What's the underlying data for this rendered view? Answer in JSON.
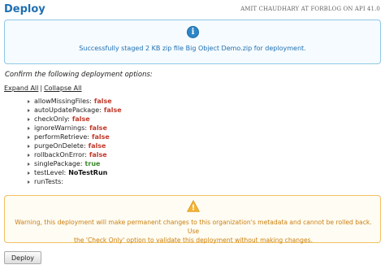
{
  "header": {
    "title": "Deploy",
    "user_info": "AMIT CHAUDHARY AT FORBLOG ON API 41.0"
  },
  "success": {
    "icon": "info-icon",
    "icon_glyph": "i",
    "message": "Successfully staged 2 KB zip file Big Object Demo.zip for deployment."
  },
  "confirm_text": "Confirm the following deployment options:",
  "links": {
    "expand_all": "Expand All",
    "separator": "|",
    "collapse_all": "Collapse All"
  },
  "options": [
    {
      "key": "allowMissingFiles:",
      "value": "false",
      "kind": "false"
    },
    {
      "key": "autoUpdatePackage:",
      "value": "false",
      "kind": "false"
    },
    {
      "key": "checkOnly:",
      "value": "false",
      "kind": "false"
    },
    {
      "key": "ignoreWarnings:",
      "value": "false",
      "kind": "false"
    },
    {
      "key": "performRetrieve:",
      "value": "false",
      "kind": "false"
    },
    {
      "key": "purgeOnDelete:",
      "value": "false",
      "kind": "false"
    },
    {
      "key": "rollbackOnError:",
      "value": "false",
      "kind": "false"
    },
    {
      "key": "singlePackage:",
      "value": "true",
      "kind": "true"
    },
    {
      "key": "testLevel:",
      "value": "NoTestRun",
      "kind": "other"
    },
    {
      "key": "runTests:",
      "value": "",
      "kind": "other"
    }
  ],
  "warning": {
    "icon": "warning-icon",
    "icon_glyph": "!",
    "line1": "Warning, this deployment will make permanent changes to this organization's metadata and cannot be rolled back. Use",
    "line2": "the 'Check Only' option to validate this deployment without making changes."
  },
  "deploy_button": "Deploy",
  "colors": {
    "title_blue": "#1f6fb2",
    "false_red": "#c0392b",
    "true_green": "#3a8a2b",
    "warning_orange": "#c97f10",
    "warning_icon_fill": "#f5b335"
  }
}
